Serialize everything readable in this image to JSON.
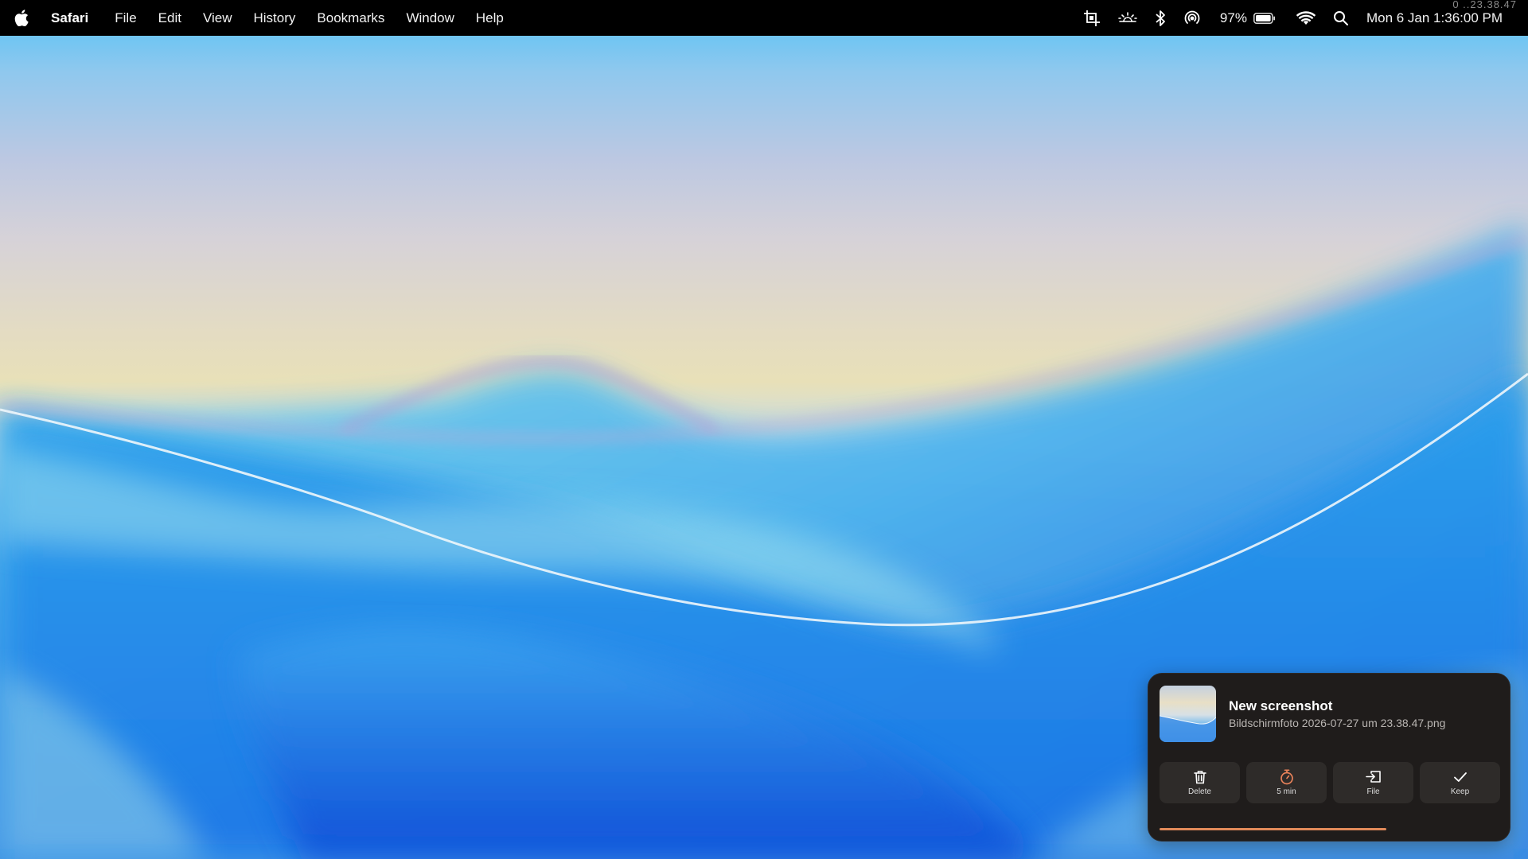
{
  "menubar": {
    "apple_icon": "apple-icon",
    "app_name": "Safari",
    "items": [
      "File",
      "Edit",
      "View",
      "History",
      "Bookmarks",
      "Window",
      "Help"
    ],
    "status": {
      "icons": [
        "crop-icon",
        "brightness-icon",
        "bluetooth-icon",
        "airdrop-icon"
      ],
      "battery_percent": "97%",
      "wifi_icon": "wifi-icon",
      "search_icon": "search-icon",
      "datetime": "Mon 6 Jan 1:36:00 PM",
      "ghost_text": "0 ..23.38.47"
    }
  },
  "notification": {
    "title": "New screenshot",
    "filename": "Bildschirmfoto 2026-07-27 um 23.38.47.png",
    "actions": [
      {
        "label": "Delete",
        "icon": "trash-icon"
      },
      {
        "label": "5 min",
        "icon": "timer-icon",
        "accent": "#e8825a"
      },
      {
        "label": "File",
        "icon": "file-move-icon"
      },
      {
        "label": "Keep",
        "icon": "checkmark-icon"
      }
    ],
    "progress": 0.67,
    "progress_color": "#e08a5a"
  }
}
